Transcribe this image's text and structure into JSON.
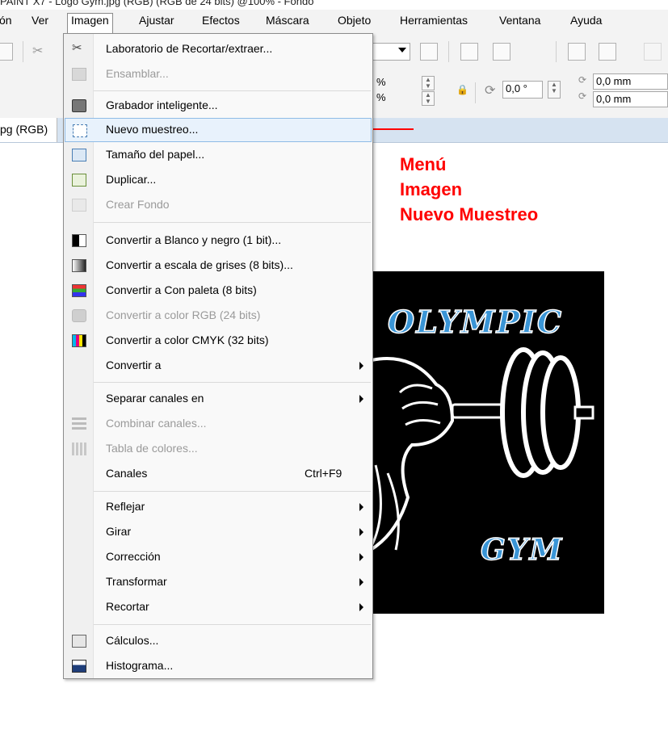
{
  "window": {
    "title": "PAINT X7 - Logo Gym.jpg (RGB) (RGB de 24 bits) @100% - Fondo"
  },
  "menubar": {
    "items": [
      "ón",
      "Ver",
      "Imagen",
      "Ajustar",
      "Efectos",
      "Máscara",
      "Objeto",
      "Herramientas",
      "Ventana",
      "Ayuda"
    ]
  },
  "toolbar": {
    "percent1": "%",
    "percent2": "%",
    "angle": "0,0 °",
    "size1": "0,0 mm",
    "size2": "0,0 mm"
  },
  "document_tab": {
    "label": "pg (RGB)"
  },
  "image_menu": {
    "items": [
      {
        "label": "Laboratorio de Recortar/extraer...",
        "icon": "scissors-icon",
        "disabled": false
      },
      {
        "label": "Ensamblar...",
        "icon": "stitch-icon",
        "disabled": true
      },
      {
        "label": "Grabador inteligente...",
        "icon": "camera-icon",
        "disabled": false
      },
      {
        "label": "Nuevo muestreo...",
        "icon": "resample-icon",
        "disabled": false,
        "highlighted": true
      },
      {
        "label": "Tamaño del papel...",
        "icon": "paper-size-icon",
        "disabled": false
      },
      {
        "label": "Duplicar...",
        "icon": "duplicate-icon",
        "disabled": false
      },
      {
        "label": "Crear Fondo",
        "icon": "background-icon",
        "disabled": true
      },
      {
        "label": "Convertir a Blanco y negro (1 bit)...",
        "icon": "black-white-icon",
        "disabled": false
      },
      {
        "label": "Convertir a escala de grises (8 bits)...",
        "icon": "grayscale-icon",
        "disabled": false
      },
      {
        "label": "Convertir a Con paleta (8 bits)",
        "icon": "palette-icon",
        "disabled": false
      },
      {
        "label": "Convertir a color RGB (24 bits)",
        "icon": "rgb-icon",
        "disabled": true
      },
      {
        "label": "Convertir a color CMYK (32 bits)",
        "icon": "cmyk-icon",
        "disabled": false
      },
      {
        "label": "Convertir a",
        "submenu": true,
        "disabled": false
      },
      {
        "label": "Separar canales en",
        "submenu": true,
        "disabled": false
      },
      {
        "label": "Combinar canales...",
        "icon": "combine-channels-icon",
        "disabled": true
      },
      {
        "label": "Tabla de colores...",
        "icon": "color-table-icon",
        "disabled": true
      },
      {
        "label": "Canales",
        "shortcut": "Ctrl+F9",
        "disabled": false
      },
      {
        "label": "Reflejar",
        "submenu": true,
        "disabled": false
      },
      {
        "label": "Girar",
        "submenu": true,
        "disabled": false
      },
      {
        "label": "Corrección",
        "submenu": true,
        "disabled": false
      },
      {
        "label": "Transformar",
        "submenu": true,
        "disabled": false
      },
      {
        "label": "Recortar",
        "submenu": true,
        "disabled": false
      },
      {
        "label": "Cálculos...",
        "icon": "calculator-icon",
        "disabled": false
      },
      {
        "label": "Histograma...",
        "icon": "histogram-icon",
        "disabled": false
      }
    ]
  },
  "annotation": {
    "lines": [
      "Menú",
      "Imagen",
      "Nuevo Muestreo"
    ],
    "color": "#ff0000"
  },
  "logo": {
    "top_text": "OLYMPIC",
    "bottom_text": "GYM",
    "text_color": "#3a95d6",
    "background": "#000000"
  }
}
